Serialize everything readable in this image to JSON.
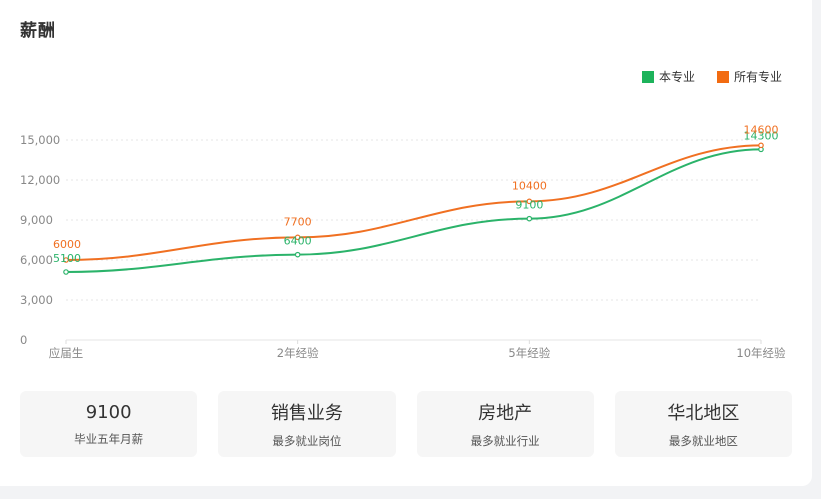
{
  "title": "薪酬",
  "legend": [
    {
      "name": "本专业",
      "color": "#1db35b"
    },
    {
      "name": "所有专业",
      "color": "#f26b11"
    }
  ],
  "chart_data": {
    "type": "line",
    "categories": [
      "应届生",
      "2年经验",
      "5年经验",
      "10年经验"
    ],
    "series": [
      {
        "name": "本专业",
        "color": "#2bb36a",
        "values": [
          5100,
          6400,
          9100,
          14300
        ]
      },
      {
        "name": "所有专业",
        "color": "#f07022",
        "values": [
          6000,
          7700,
          10400,
          14600
        ]
      }
    ],
    "series_label_texts": [
      [
        "5100",
        "6400",
        "9100",
        "14300"
      ],
      [
        "6000",
        "7700",
        "10400",
        "14600"
      ]
    ],
    "yticks": [
      0,
      3000,
      6000,
      9000,
      12000,
      15000
    ],
    "ytick_labels": [
      "0",
      "3,000",
      "6,000",
      "9,000",
      "12,000",
      "15,000"
    ],
    "ylim": [
      0,
      15000
    ],
    "grid": true,
    "legend_position": "top-right"
  },
  "stats": [
    {
      "value": "9100",
      "label": "毕业五年月薪"
    },
    {
      "value": "销售业务",
      "label": "最多就业岗位"
    },
    {
      "value": "房地产",
      "label": "最多就业行业"
    },
    {
      "value": "华北地区",
      "label": "最多就业地区"
    }
  ]
}
